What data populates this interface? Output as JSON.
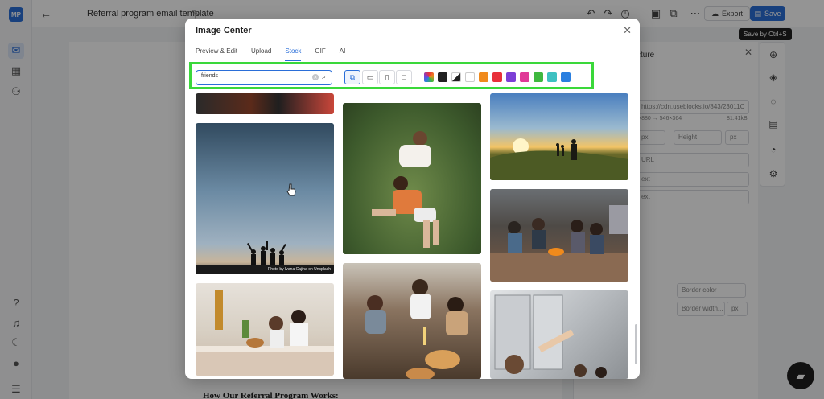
{
  "app": {
    "logo": "MP",
    "document_title": "Referral program email template",
    "export_label": "Export",
    "save_label": "Save",
    "save_tooltip": "Save by Ctrl+S",
    "canvas_heading": "How Our Referral Program Works:"
  },
  "right_panel": {
    "title": "cture",
    "url_value": "https://cdn.useblocks.io/843/23011C",
    "size_info": "×880 → 546×364",
    "file_size": "81.41kB",
    "height_placeholder": "Height",
    "unit_1": "px",
    "unit_2": "px",
    "url_placeholder": "URL",
    "alt_placeholder": "ext",
    "link_placeholder": "ext",
    "border_color_placeholder": "Border color",
    "border_width_placeholder": "Border width...",
    "border_unit": "px"
  },
  "modal": {
    "title": "Image Center",
    "tabs": [
      {
        "label": "Preview & Edit",
        "active": false
      },
      {
        "label": "Upload",
        "active": false
      },
      {
        "label": "Stock",
        "active": true
      },
      {
        "label": "GIF",
        "active": false
      },
      {
        "label": "AI",
        "active": false
      }
    ],
    "search": {
      "value": "friends",
      "placeholder": "Search"
    },
    "orientation_options": [
      "all-orientations-icon",
      "landscape-icon",
      "portrait-icon",
      "square-icon"
    ],
    "color_filters": [
      "rainbow",
      "#222222",
      "black-white",
      "#ffffff",
      "#f08a1c",
      "#e8303a",
      "#7b3fd6",
      "#e03a97",
      "#3fb83f",
      "#3ec1c1",
      "#2a7fe0"
    ],
    "highlight_color": "#3ad83a",
    "images": {
      "col1": [
        "Group of friends at night",
        "Friends on a hill at dusk",
        "Friends in a bedroom"
      ],
      "col2": [
        "Couple lying in grass",
        "Friends toasting at a party"
      ],
      "col3": [
        "Friends on a hill at sunset",
        "Friends by a campfire",
        "Friends reaching up in a window"
      ]
    },
    "photo_credit": "Photo by Ivana Cajina on Unsplash"
  },
  "colors": {
    "accent": "#2a6ed8"
  }
}
